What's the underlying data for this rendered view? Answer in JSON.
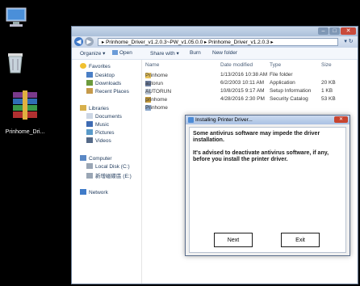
{
  "desktop": {
    "winrar_label": "Prinhome_Dri..."
  },
  "explorer": {
    "address_path": "▸ Prinhome_Driver_v1.2.0.3~PW_v1.05.0.0 ▸ Prinhome_Driver_v1.2.0.3 ▸",
    "toolbar": {
      "organize": "Organize ▾",
      "open": "Open",
      "share_with": "Share with ▾",
      "burn": "Burn",
      "new_folder": "New folder"
    },
    "nav": {
      "favorites": "Favorites",
      "desktop": "Desktop",
      "downloads": "Downloads",
      "recent_places": "Recent Places",
      "libraries": "Libraries",
      "documents": "Documents",
      "music": "Music",
      "pictures": "Pictures",
      "videos": "Videos",
      "computer": "Computer",
      "local_disk": "Local Disk (C:)",
      "drive_e": "新增磁碟區 (E:)",
      "network": "Network"
    },
    "columns": {
      "name": "Name",
      "date_modified": "Date modified",
      "type": "Type",
      "size": "Size"
    },
    "files": [
      {
        "name": "Prinhome",
        "date": "1/13/2016 10:38 AM",
        "type": "File folder",
        "size": ""
      },
      {
        "name": "autorun",
        "date": "6/2/2003 10:11 AM",
        "type": "Application",
        "size": "20 KB"
      },
      {
        "name": "AUTORUN",
        "date": "10/8/2015 9:17 AM",
        "type": "Setup Information",
        "size": "1 KB"
      },
      {
        "name": "prinhome",
        "date": "4/28/2016 2:30 PM",
        "type": "Security Catalog",
        "size": "53 KB"
      },
      {
        "name": "Prinhome",
        "date": "",
        "type": "",
        "size": ""
      }
    ]
  },
  "dialog": {
    "title": "Installing Printer Driver...",
    "message_1": "Some antivirus software may impede the driver installation.",
    "message_2": "It's advised to deactivate antivirus software, if any, before you install the printer driver.",
    "next_label": "Next",
    "exit_label": "Exit"
  },
  "colors": {
    "desktop_bg": "#000000",
    "title_accent": "#a9c1e3",
    "close_red": "#c8442f"
  }
}
